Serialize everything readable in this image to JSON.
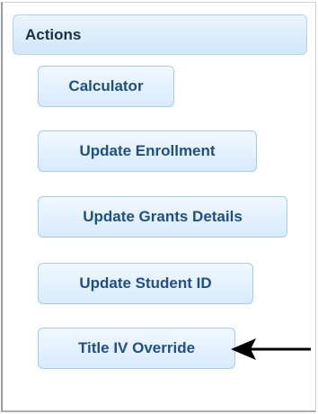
{
  "actions_panel": {
    "title": "Actions",
    "buttons": [
      {
        "label": "Calculator"
      },
      {
        "label": "Update Enrollment"
      },
      {
        "label": "Update Grants Details"
      },
      {
        "label": "Update Student ID"
      },
      {
        "label": "Title IV Override"
      }
    ]
  },
  "annotation": {
    "arrow_icon": "left-arrow-icon",
    "arrow_color": "#000000"
  },
  "colors": {
    "header_bg": "#dcecfb",
    "button_border": "#a8cbea",
    "button_text": "#1f4f84"
  }
}
